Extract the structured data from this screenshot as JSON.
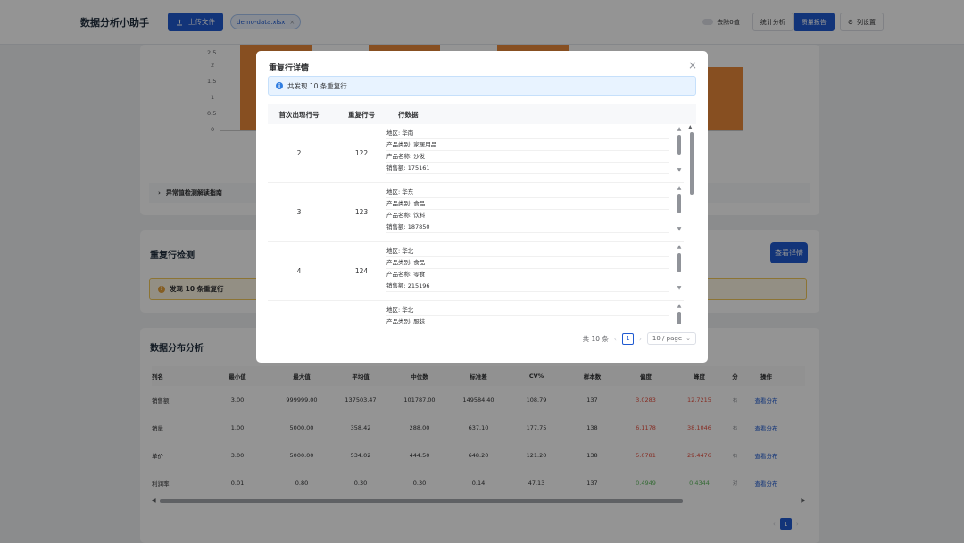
{
  "header": {
    "title": "数据分析小助手",
    "upload_label": "上传文件",
    "file_tag": "demo-data.xlsx",
    "remove_zero": "去除0值",
    "stats": "统计分析",
    "quality": "质量报告",
    "column_settings": "列设置"
  },
  "chart": {
    "yticks": [
      "2.5",
      "2",
      "1.5",
      "1",
      "0.5",
      "0"
    ]
  },
  "anomaly": {
    "guide_label": "异常值检测解读指南"
  },
  "duplicate": {
    "title": "重复行检测",
    "detail_button": "查看详情",
    "warning": "发现 10 条重复行"
  },
  "distribution": {
    "title": "数据分布分析",
    "headers": [
      "列名",
      "最小值",
      "最大值",
      "平均值",
      "中位数",
      "标准差",
      "CV%",
      "样本数",
      "偏度",
      "峰度",
      "分",
      "操作"
    ],
    "rows": [
      {
        "name": "销售额",
        "min": "3.00",
        "max": "999999.00",
        "mean": "137503.47",
        "median": "101787.00",
        "std": "149584.40",
        "cv": "108.79",
        "n": "137",
        "skew": "3.0283",
        "kurt": "12.7215",
        "dist": "右",
        "action": "查看分布"
      },
      {
        "name": "销量",
        "min": "1.00",
        "max": "5000.00",
        "mean": "358.42",
        "median": "288.00",
        "std": "637.10",
        "cv": "177.75",
        "n": "138",
        "skew": "6.1178",
        "kurt": "38.1046",
        "dist": "右",
        "action": "查看分布"
      },
      {
        "name": "单价",
        "min": "3.00",
        "max": "5000.00",
        "mean": "534.02",
        "median": "444.50",
        "std": "648.20",
        "cv": "121.20",
        "n": "138",
        "skew": "5.0781",
        "kurt": "29.4476",
        "dist": "右",
        "action": "查看分布"
      },
      {
        "name": "利润率",
        "min": "0.01",
        "max": "0.80",
        "mean": "0.30",
        "median": "0.30",
        "std": "0.14",
        "cv": "47.13",
        "n": "137",
        "skew": "0.4949",
        "kurt": "0.4344",
        "dist": "对",
        "action": "查看分布"
      }
    ],
    "page": "1"
  },
  "dialog": {
    "title": "重复行详情",
    "info": "共发现 10 条重复行",
    "col_first": "首次出现行号",
    "col_dup": "重复行号",
    "col_data": "行数据",
    "rows": [
      {
        "first": "2",
        "dup": "122",
        "lines": [
          "地区: 华南",
          "产品类别: 家居用品",
          "产品名称: 沙发",
          "销售额: 175161"
        ]
      },
      {
        "first": "3",
        "dup": "123",
        "lines": [
          "地区: 华东",
          "产品类别: 食品",
          "产品名称: 饮料",
          "销售额: 187850"
        ]
      },
      {
        "first": "4",
        "dup": "124",
        "lines": [
          "地区: 华北",
          "产品类别: 食品",
          "产品名称: 零食",
          "销售额: 215196"
        ]
      },
      {
        "first": "",
        "dup": "",
        "lines": [
          "地区: 华北",
          "产品类别: 服装"
        ]
      }
    ],
    "total": "共 10 条",
    "page": "1",
    "page_size": "10 / page"
  }
}
